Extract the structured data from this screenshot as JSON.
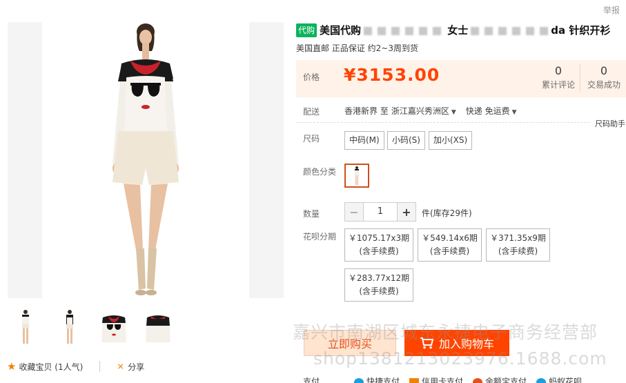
{
  "header": {
    "report": "举报"
  },
  "product": {
    "tag": "代购",
    "title_part1": "美国代购",
    "title_part2": "女士",
    "title_part3": "da 针织开衫",
    "subtitle": "美国直邮 正品保证 约2~3周到货"
  },
  "price": {
    "label": "价格",
    "value": "¥3153.00",
    "reviews_count": "0",
    "reviews_label": "累计评论",
    "sales_count": "0",
    "sales_label": "交易成功"
  },
  "shipping": {
    "label": "配送",
    "from": "香港新界 至",
    "to": "浙江嘉兴秀洲区",
    "method": "快递 免运费",
    "size_helper": "尺码助手"
  },
  "size": {
    "label": "尺码",
    "options": [
      "中码(M)",
      "小码(S)",
      "加小(XS)"
    ]
  },
  "color": {
    "label": "颜色分类"
  },
  "quantity": {
    "label": "数量",
    "minus": "−",
    "value": "1",
    "plus": "+",
    "stock": "件(库存29件)"
  },
  "installment": {
    "label": "花呗分期",
    "options": [
      {
        "amount": "￥1075.17x3期",
        "fee": "(含手续费)"
      },
      {
        "amount": "￥549.14x6期",
        "fee": "(含手续费)"
      },
      {
        "amount": "￥371.35x9期",
        "fee": "(含手续费)"
      },
      {
        "amount": "￥283.77x12期",
        "fee": "(含手续费)"
      }
    ]
  },
  "buttons": {
    "buy_now": "立即购买",
    "add_to_cart": "加入购物车"
  },
  "watermark": {
    "line1": "嘉兴市南湖区城东永捷电子商务经营部",
    "line2": "shop1381213023976.1688.com"
  },
  "actions": {
    "favorite": "收藏宝贝 (1人气)",
    "share": "分享"
  },
  "payment": {
    "label": "支付",
    "methods": [
      "快捷支付",
      "信用卡支付",
      "余额宝支付",
      "蚂蚁花呗"
    ]
  },
  "colors": {
    "accent": "#ff4400",
    "tag_green": "#0db25d",
    "price_bg": "#fff2e8"
  }
}
